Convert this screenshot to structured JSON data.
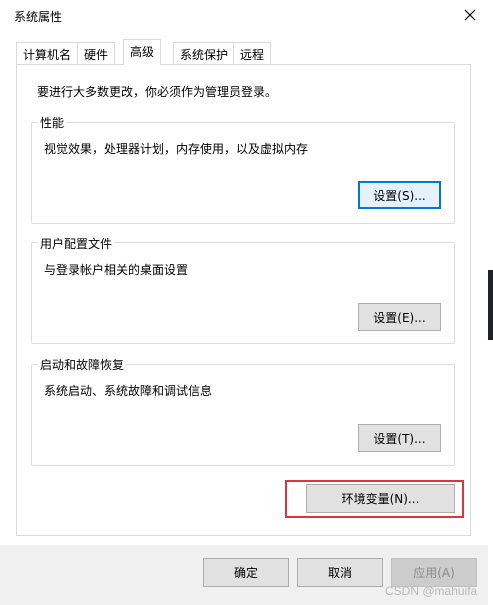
{
  "window": {
    "title": "系统属性",
    "close_symbol": "✕"
  },
  "tabs": [
    {
      "label": "计算机名",
      "active": false
    },
    {
      "label": "硬件",
      "active": false
    },
    {
      "label": "高级",
      "active": true
    },
    {
      "label": "系统保护",
      "active": false
    },
    {
      "label": "远程",
      "active": false
    }
  ],
  "intro_text": "要进行大多数更改，你必须作为管理员登录。",
  "groups": {
    "performance": {
      "title": "性能",
      "description": "视觉效果，处理器计划，内存使用，以及虚拟内存",
      "button_label": "设置(S)..."
    },
    "user_profiles": {
      "title": "用户配置文件",
      "description": "与登录帐户相关的桌面设置",
      "button_label": "设置(E)..."
    },
    "startup_recovery": {
      "title": "启动和故障恢复",
      "description": "系统启动、系统故障和调试信息",
      "button_label": "设置(T)..."
    }
  },
  "env_button_label": "环境变量(N)...",
  "footer": {
    "ok_label": "确定",
    "cancel_label": "取消",
    "apply_label": "应用(A)"
  },
  "watermark": "CSDN @mahuifa",
  "colors": {
    "focus_border": "#0078d7",
    "highlight_border": "#d9363e",
    "button_face": "#e1e1e1"
  }
}
